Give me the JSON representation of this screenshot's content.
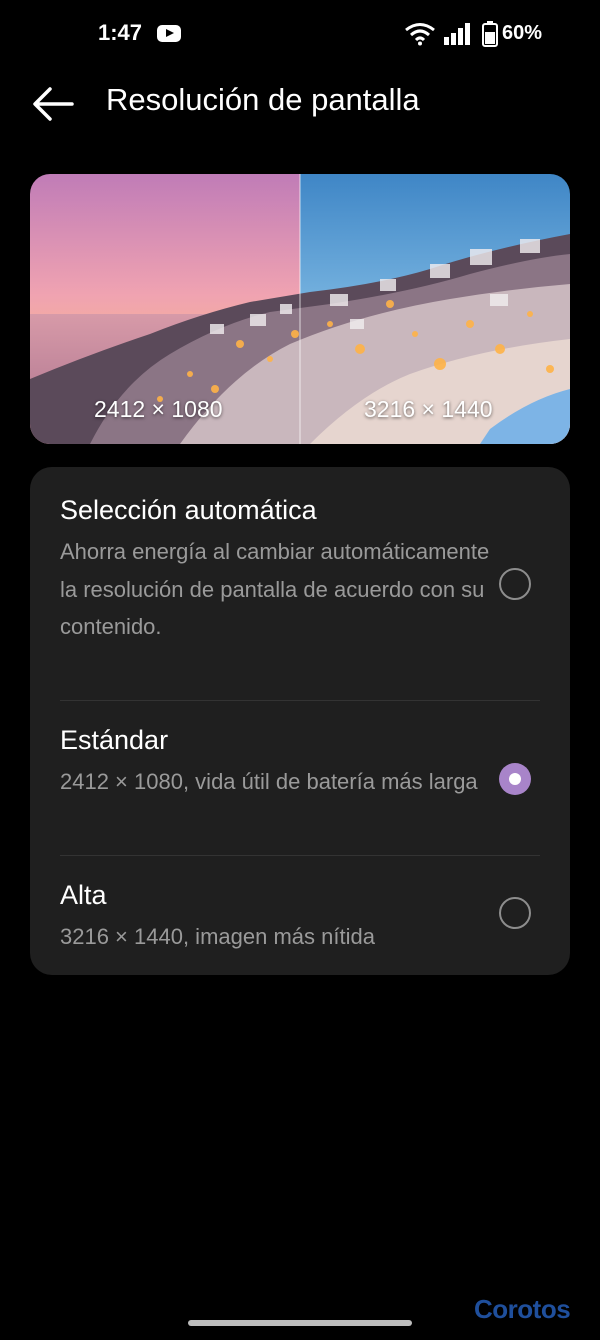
{
  "status_bar": {
    "time": "1:47",
    "battery": "60%",
    "icons": [
      "youtube-icon",
      "wifi-icon",
      "signal-icon",
      "battery-icon"
    ]
  },
  "header": {
    "title": "Resolución de pantalla",
    "back_icon": "back-arrow-icon"
  },
  "preview": {
    "left_label": "2412 × 1080",
    "right_label": "3216 × 1440"
  },
  "options": [
    {
      "title": "Selección automática",
      "description": "Ahorra energía al cambiar automáticamente la resolución de pantalla de acuerdo con su contenido.",
      "selected": false
    },
    {
      "title": "Estándar",
      "description": "2412 × 1080, vida útil de batería más larga",
      "selected": true
    },
    {
      "title": "Alta",
      "description": "3216 × 1440, imagen más nítida",
      "selected": false
    }
  ],
  "watermark": "Corotos",
  "colors": {
    "background": "#000000",
    "card": "#1f1f1f",
    "accent": "#a884c9",
    "secondary_text": "#9a9a9a"
  }
}
